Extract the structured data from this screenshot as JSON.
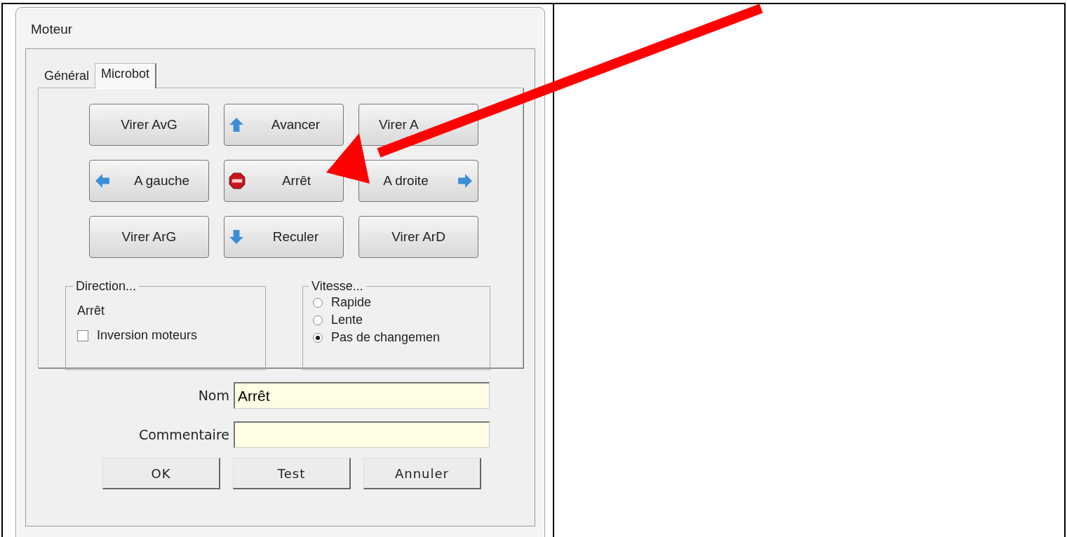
{
  "window": {
    "title": "Moteur"
  },
  "tabs": [
    {
      "label": "Général",
      "selected": false
    },
    {
      "label": "Microbot",
      "selected": true
    }
  ],
  "move_buttons": [
    {
      "label": "Virer AvG"
    },
    {
      "label": "Avancer"
    },
    {
      "label": "Virer A"
    },
    {
      "label": "A gauche"
    },
    {
      "label": "Arrêt"
    },
    {
      "label": "A droite"
    },
    {
      "label": "Virer ArG"
    },
    {
      "label": "Reculer"
    },
    {
      "label": "Virer ArD"
    }
  ],
  "direction": {
    "title": "Direction...",
    "value": "Arrêt",
    "checkbox": {
      "label": "Inversion moteurs",
      "checked": false
    }
  },
  "speed": {
    "title": "Vitesse...",
    "options": [
      {
        "label": "Rapide",
        "selected": false
      },
      {
        "label": "Lente",
        "selected": false
      },
      {
        "label": "Pas de changemen",
        "selected": true
      }
    ]
  },
  "fields": [
    {
      "label": "Nom",
      "value": "Arrêt"
    },
    {
      "label": "Commentaire"
    }
  ],
  "buttons": [
    "OK",
    "Test",
    "Annuler"
  ]
}
